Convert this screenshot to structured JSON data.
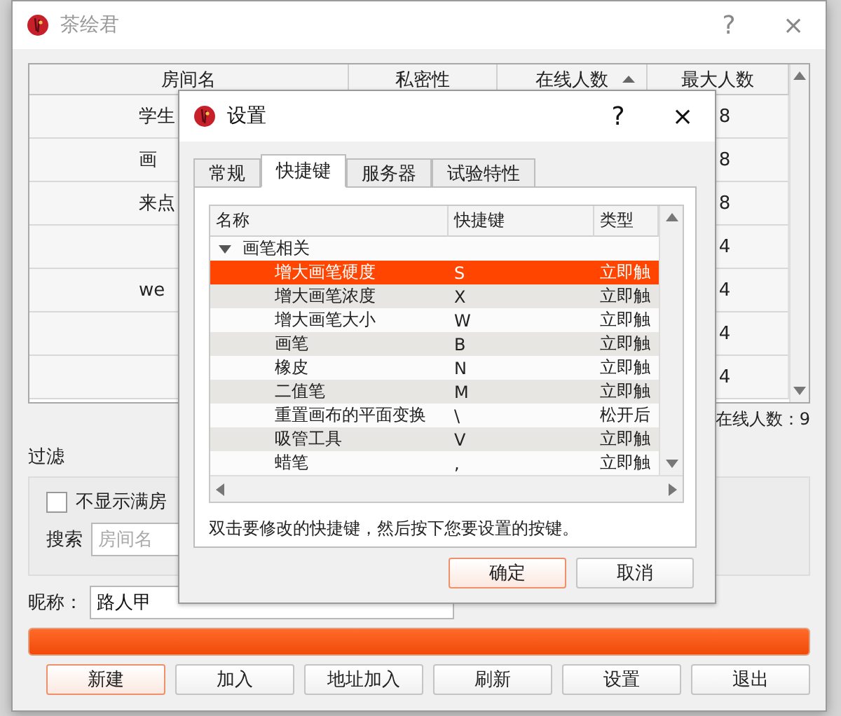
{
  "main_window": {
    "title": "茶绘君",
    "help": "?",
    "close": "×",
    "table": {
      "columns": [
        {
          "label": "房间名",
          "sorted": false
        },
        {
          "label": "私密性",
          "sorted": false
        },
        {
          "label": "在线人数",
          "sorted": true
        },
        {
          "label": "最大人数",
          "sorted": false
        }
      ],
      "rows": [
        {
          "name": "学生",
          "max": "8"
        },
        {
          "name": "画",
          "max": "8"
        },
        {
          "name": "来点",
          "max": "8"
        },
        {
          "name": "",
          "max": "4"
        },
        {
          "name": "we",
          "max": "4"
        },
        {
          "name": "",
          "max": "4"
        },
        {
          "name": "",
          "max": "4"
        }
      ]
    },
    "online_count": "在线人数：9",
    "filter": {
      "title": "过滤",
      "hide_full": {
        "label": "不显示满房",
        "checked": false
      },
      "search_label": "搜索",
      "search_placeholder": "房间名"
    },
    "nickname": {
      "label": "昵称：",
      "value": "路人甲"
    },
    "progress": {
      "level": 1
    },
    "buttons": [
      {
        "label": "新建",
        "default": true
      },
      {
        "label": "加入",
        "default": false
      },
      {
        "label": "地址加入",
        "default": false
      },
      {
        "label": "刷新",
        "default": false
      },
      {
        "label": "设置",
        "default": false
      },
      {
        "label": "退出",
        "default": false
      }
    ]
  },
  "dialog": {
    "title": "设置",
    "help": "?",
    "close": "×",
    "tabs": [
      {
        "label": "常规",
        "selected": false
      },
      {
        "label": "快捷键",
        "selected": true
      },
      {
        "label": "服务器",
        "selected": false
      },
      {
        "label": "试验特性",
        "selected": false
      }
    ],
    "tree": {
      "columns": [
        "名称",
        "快捷键",
        "类型"
      ],
      "groups": [
        {
          "label": "画笔相关",
          "expanded": true,
          "children": [
            {
              "name": "增大画笔硬度",
              "key": "S",
              "type": "立即触",
              "selected": true
            },
            {
              "name": "增大画笔浓度",
              "key": "X",
              "type": "立即触",
              "selected": false
            },
            {
              "name": "增大画笔大小",
              "key": "W",
              "type": "立即触",
              "selected": false
            },
            {
              "name": "画笔",
              "key": "B",
              "type": "立即触",
              "selected": false
            },
            {
              "name": "橡皮",
              "key": "N",
              "type": "立即触",
              "selected": false
            },
            {
              "name": "二值笔",
              "key": "M",
              "type": "立即触",
              "selected": false
            },
            {
              "name": "重置画布的平面变换",
              "key": "\\",
              "type": "松开后",
              "selected": false
            },
            {
              "name": "吸管工具",
              "key": "V",
              "type": "立即触",
              "selected": false
            },
            {
              "name": "蜡笔",
              "key": ",",
              "type": "立即触",
              "selected": false
            }
          ]
        }
      ]
    },
    "hint": "双击要修改的快捷键，然后按下您要设置的按键。",
    "buttons": [
      {
        "label": "确定",
        "default": true
      },
      {
        "label": "取消",
        "default": false
      }
    ]
  }
}
